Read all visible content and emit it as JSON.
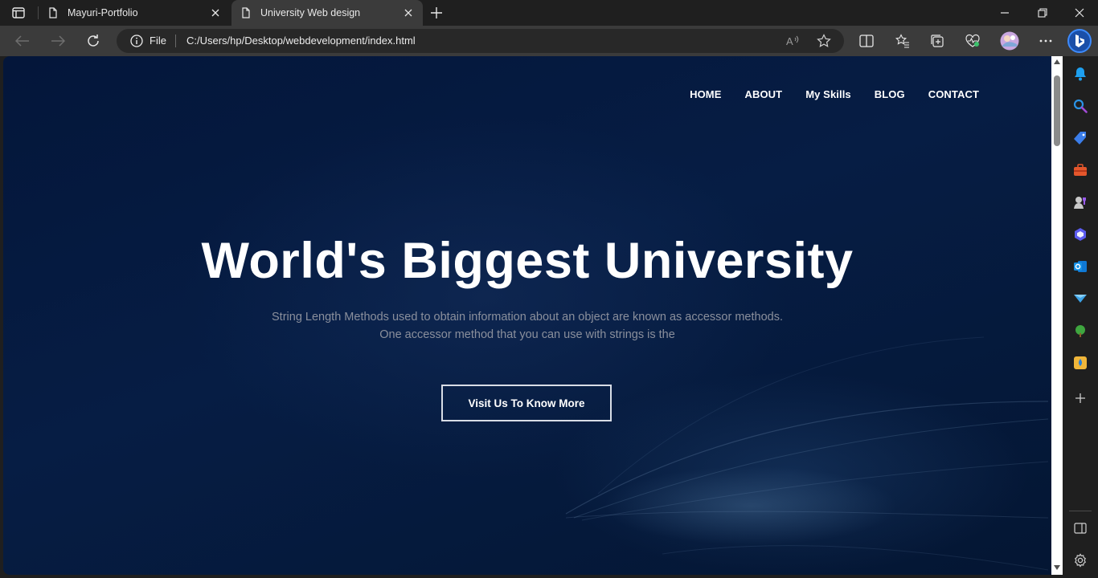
{
  "browser": {
    "tabs": [
      {
        "title": "Mayuri-Portfolio",
        "active": false
      },
      {
        "title": "University Web design",
        "active": true
      }
    ],
    "address": {
      "scheme_label": "File",
      "url": "C:/Users/hp/Desktop/webdevelopment/index.html"
    },
    "colors": {
      "chrome_dark": "#1f1f1f",
      "toolbar": "#3b3b3b",
      "omnibox": "#282828"
    }
  },
  "page": {
    "nav": [
      "HOME",
      "ABOUT",
      "My Skills",
      "BLOG",
      "CONTACT"
    ],
    "hero": {
      "title": "World's Biggest University",
      "subtitle_line1": "String Length Methods used to obtain information about an object are known as accessor methods.",
      "subtitle_line2": "One accessor method that you can use with strings is the",
      "cta_label": "Visit Us To Know More"
    },
    "colors": {
      "background": "#061d44",
      "title": "#ffffff",
      "subtitle": "#8a8f9c"
    }
  },
  "sidebar_icons": [
    "bell-icon",
    "search-icon",
    "shopping-tag-icon",
    "tools-icon",
    "games-icon",
    "copilot-icon",
    "outlook-icon",
    "telegram-icon",
    "tree-icon",
    "drop-icon",
    "add-icon",
    "split-panel-icon",
    "settings-icon"
  ]
}
